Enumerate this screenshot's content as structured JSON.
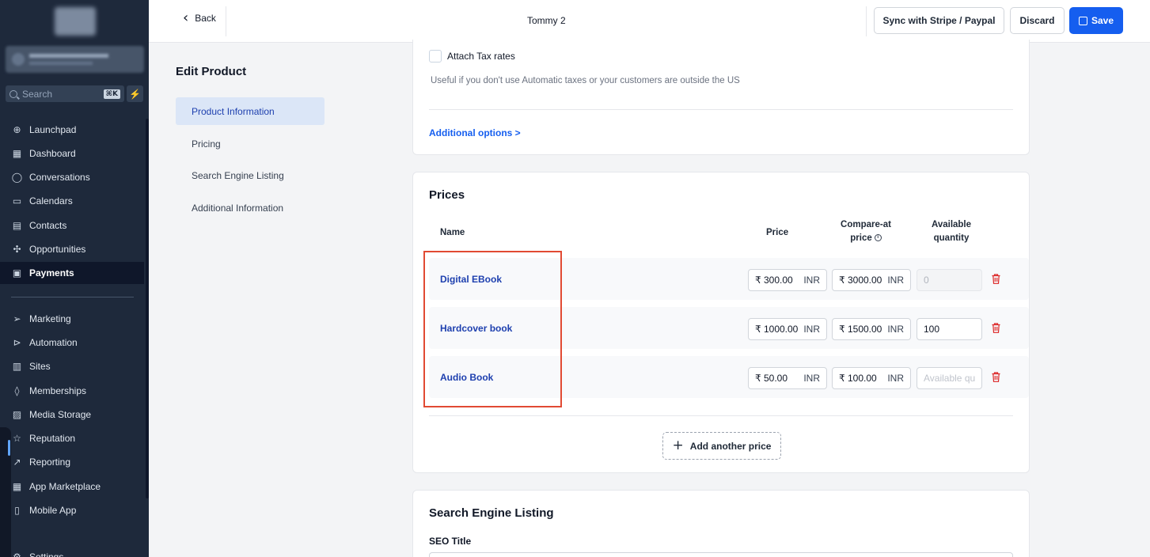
{
  "sidebar": {
    "search_placeholder": "Search",
    "search_shortcut": "⌘K",
    "items": [
      {
        "label": "Launchpad",
        "icon": "rocket-icon"
      },
      {
        "label": "Dashboard",
        "icon": "grid-icon"
      },
      {
        "label": "Conversations",
        "icon": "chat-icon"
      },
      {
        "label": "Calendars",
        "icon": "calendar-icon"
      },
      {
        "label": "Contacts",
        "icon": "contacts-icon"
      },
      {
        "label": "Opportunities",
        "icon": "opportunities-icon"
      },
      {
        "label": "Payments",
        "icon": "payments-icon"
      },
      {
        "label": "Marketing",
        "icon": "send-icon"
      },
      {
        "label": "Automation",
        "icon": "automation-icon"
      },
      {
        "label": "Sites",
        "icon": "sites-icon"
      },
      {
        "label": "Memberships",
        "icon": "memberships-icon"
      },
      {
        "label": "Media Storage",
        "icon": "image-icon"
      },
      {
        "label": "Reputation",
        "icon": "star-icon"
      },
      {
        "label": "Reporting",
        "icon": "trend-icon"
      },
      {
        "label": "App Marketplace",
        "icon": "apps-icon"
      },
      {
        "label": "Mobile App",
        "icon": "mobile-icon"
      },
      {
        "label": "Settings",
        "icon": "gear-icon"
      }
    ]
  },
  "topbar": {
    "back_label": "Back",
    "title": "Tommy 2",
    "sync_label": "Sync with Stripe / Paypal",
    "discard_label": "Discard",
    "save_label": "Save"
  },
  "left_menu": {
    "title": "Edit Product",
    "items": [
      "Product Information",
      "Pricing",
      "Search Engine Listing",
      "Additional Information"
    ]
  },
  "tax": {
    "checkbox_label": "Attach Tax rates",
    "hint": "Useful if you don't use Automatic taxes or your customers are outside the US",
    "additional_options": "Additional options >"
  },
  "prices": {
    "title": "Prices",
    "headers": {
      "name": "Name",
      "price": "Price",
      "compare_line1": "Compare-at",
      "compare_line2": "price",
      "qty_line1": "Available",
      "qty_line2": "quantity"
    },
    "rows": [
      {
        "name": "Digital EBook",
        "price": "₹ 300.00",
        "compare": "₹ 3000.00",
        "currency": "INR",
        "qty": "0",
        "qty_state": "disabled"
      },
      {
        "name": "Hardcover book",
        "price": "₹ 1000.00",
        "compare": "₹ 1500.00",
        "currency": "INR",
        "qty": "100",
        "qty_state": "value"
      },
      {
        "name": "Audio Book",
        "price": "₹ 50.00",
        "compare": "₹ 100.00",
        "currency": "INR",
        "qty": "Available qu",
        "qty_state": "placeholder"
      }
    ],
    "add_label": "Add another price"
  },
  "seo": {
    "title": "Search Engine Listing",
    "seo_title_label": "SEO Title"
  },
  "colors": {
    "sidebar_bg": "#1e293b",
    "accent": "#155eef",
    "link": "#1e40af",
    "highlight": "#e14a33",
    "trash": "#dc2626"
  }
}
